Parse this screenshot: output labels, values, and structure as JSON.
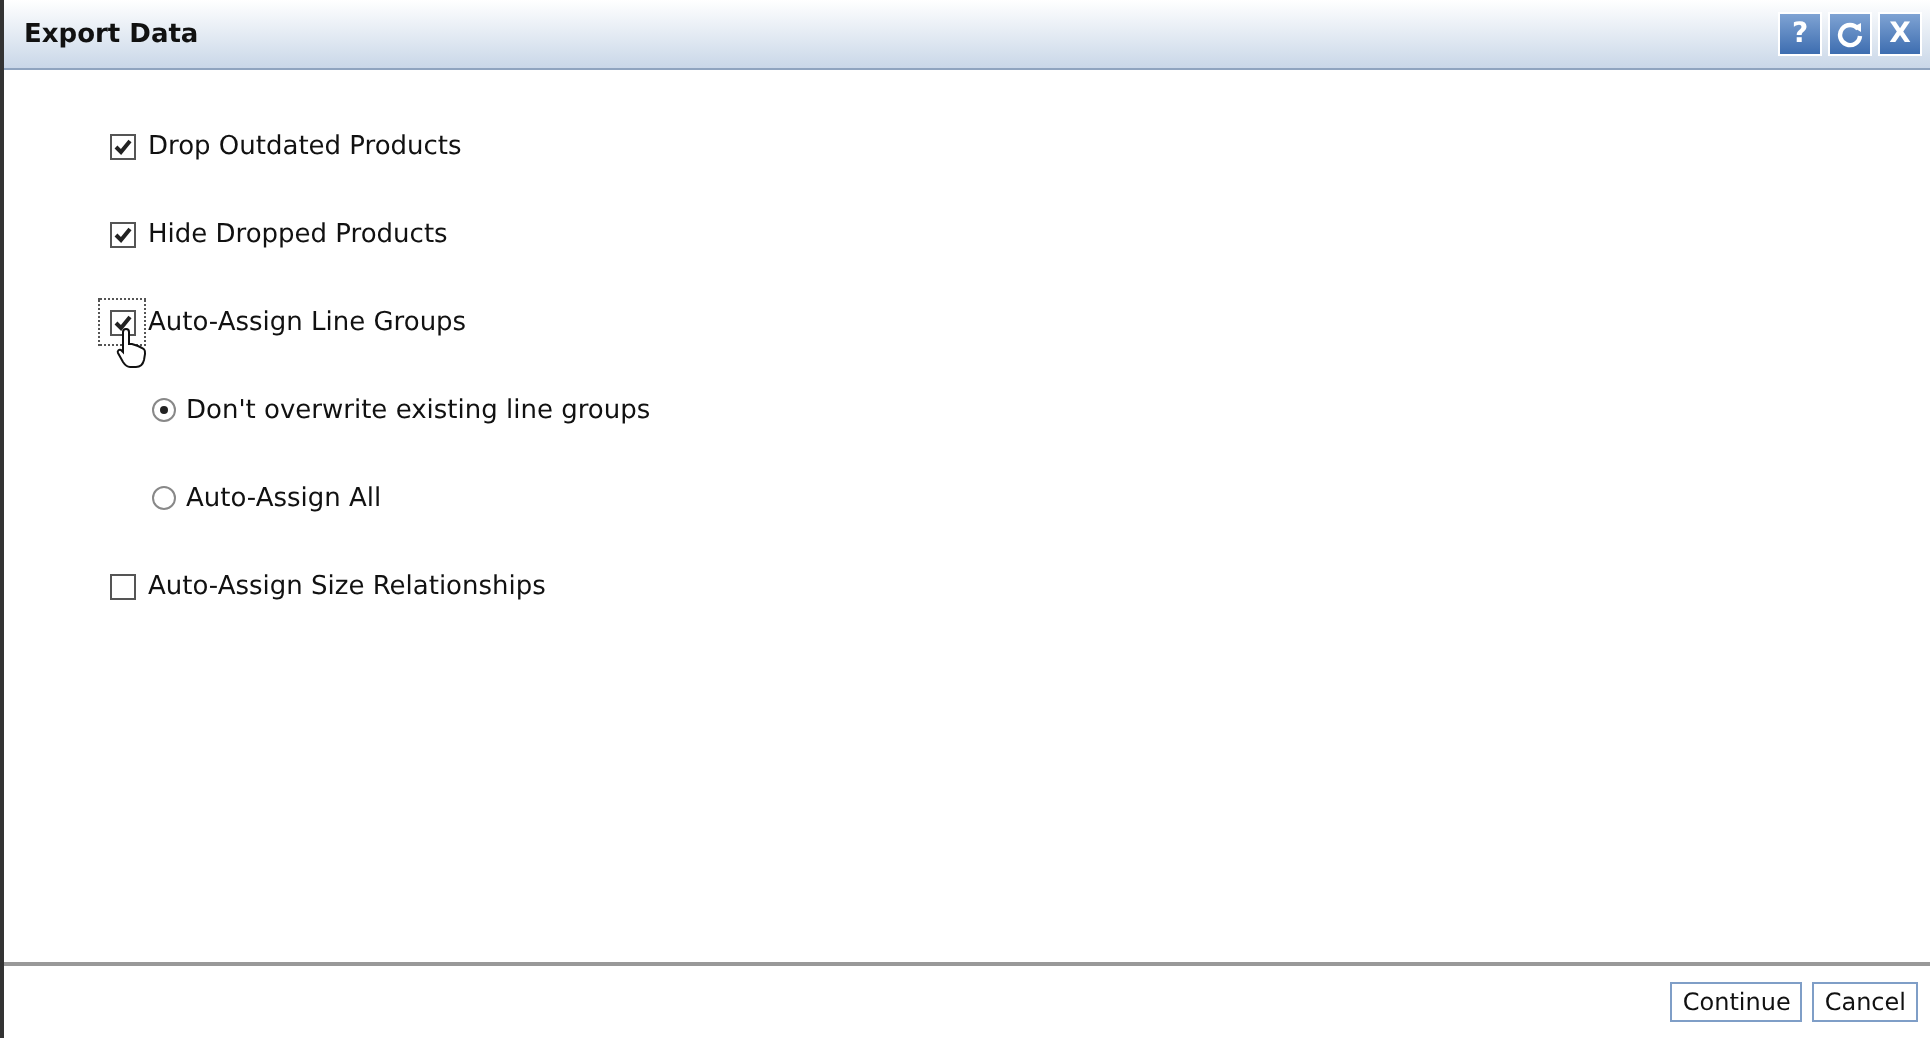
{
  "window": {
    "title": "Export Data",
    "buttons": [
      {
        "kind": "help",
        "label": "?"
      },
      {
        "kind": "refresh"
      },
      {
        "kind": "close",
        "label": "X"
      }
    ]
  },
  "options": [
    {
      "kind": "checkbox",
      "label": "Drop Outdated Products",
      "checked": true,
      "focused": false
    },
    {
      "kind": "checkbox",
      "label": "Hide Dropped Products",
      "checked": true,
      "focused": false
    },
    {
      "kind": "checkbox",
      "label": "Auto-Assign Line Groups",
      "checked": true,
      "focused": true,
      "children": [
        {
          "kind": "radio",
          "label": "Don't overwrite existing line groups",
          "selected": true
        },
        {
          "kind": "radio",
          "label": "Auto-Assign All",
          "selected": false
        }
      ]
    },
    {
      "kind": "checkbox",
      "label": "Auto-Assign Size Relationships",
      "checked": false,
      "focused": false
    }
  ],
  "footer": {
    "buttons": [
      "Continue",
      "Cancel"
    ]
  }
}
